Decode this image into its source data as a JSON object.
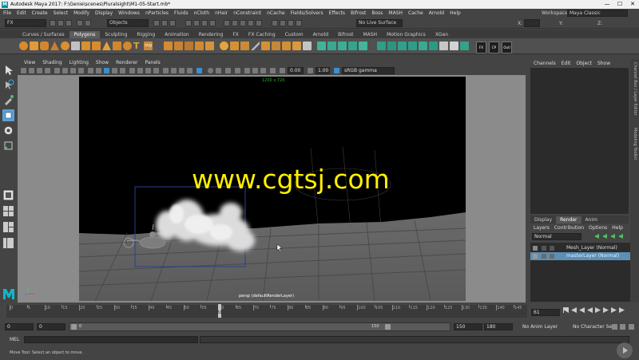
{
  "window": {
    "title": "Autodesk Maya 2017: F:\\Genie\\scenes\\Pluralsight\\M1-05-Start.mb*",
    "logo": "M",
    "minimize": "—",
    "maximize": "☐",
    "close": "✕"
  },
  "menubar": [
    "File",
    "Edit",
    "Create",
    "Select",
    "Modify",
    "Display",
    "Windows",
    "nParticles",
    "Fluids",
    "nCloth",
    "nHair",
    "nConstraint",
    "nCache",
    "Fields/Solvers",
    "Effects",
    "Bifrost",
    "Boss",
    "MASH",
    "Cache",
    "Arnold",
    "Help"
  ],
  "statusline": {
    "menuset": "FX",
    "select_mode": "Objects",
    "live_surface": "No Live Surface",
    "workspace_label": "Workspace :",
    "workspace_value": "Maya Classic",
    "coord_x": "X:",
    "coord_y": "Y:",
    "coord_z": "Z:"
  },
  "shelf_tabs": [
    "Curves / Surfaces",
    "Polygons",
    "Sculpting",
    "Rigging",
    "Animation",
    "Rendering",
    "FX",
    "FX Caching",
    "Custom",
    "Arnold",
    "Bifrost",
    "MASH",
    "Motion Graphics",
    "XGen"
  ],
  "shelf_active": "Polygons",
  "shelf_labels": {
    "fx": "FX",
    "cp": "CP",
    "outl": "Outl"
  },
  "viewport": {
    "menu": [
      "View",
      "Shading",
      "Lighting",
      "Show",
      "Renderer",
      "Panels"
    ],
    "exposure": "0.00",
    "gamma": "1.00",
    "color_space": "sRGB gamma",
    "resolution": "1200 x 720",
    "camera_label": "persp (defaultRenderLayer)",
    "watermark": "www.cgtsj.com"
  },
  "channel_box": {
    "menu": [
      "Channels",
      "Edit",
      "Object",
      "Show"
    ],
    "side_tab_1": "Channel Box / Layer Editor",
    "side_tab_2": "Modeling Toolkit"
  },
  "layer_editor": {
    "tabs": [
      "Display",
      "Render",
      "Anim"
    ],
    "active_tab": "Render",
    "menu": [
      "Layers",
      "Contribution",
      "Options",
      "Help"
    ],
    "blend_mode": "Normal",
    "layers": [
      {
        "name": "Mesh_Layer (Normal)",
        "selected": false
      },
      {
        "name": "masterLayer (Normal)",
        "selected": true
      }
    ]
  },
  "timeline": {
    "ticks": [
      "0",
      "5",
      "10",
      "15",
      "20",
      "25",
      "30",
      "35",
      "40",
      "45",
      "50",
      "55",
      "60",
      "65",
      "70",
      "75",
      "80",
      "85",
      "90",
      "95",
      "100",
      "105",
      "110",
      "115",
      "120",
      "125",
      "130",
      "135",
      "140",
      "145"
    ],
    "current_frame_marker": "61",
    "current_frame_field": "61"
  },
  "range": {
    "start": "0",
    "playback_start": "0",
    "slider_start": "0",
    "slider_end": "150",
    "playback_end": "150",
    "end": "180",
    "anim_layer": "No Anim Layer",
    "character_set": "No Character Set"
  },
  "command_line": {
    "label": "MEL"
  },
  "help_line": "Move Tool: Select an object to move."
}
